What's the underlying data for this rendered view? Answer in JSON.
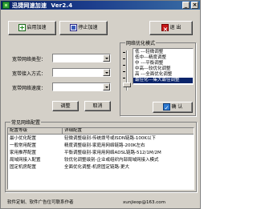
{
  "window": {
    "title": "迅捷网速加速",
    "version": "Ver2.4"
  },
  "toolbar": {
    "enable_label": "启用加速",
    "stop_label": "停止加速",
    "exit_label": "退 出"
  },
  "form": {
    "bandwidth_type_label": "宽带网络类型：",
    "access_mode_label": "宽带接入方式：",
    "speed_label": "宽带网络速度：",
    "bandwidth_type_value": "",
    "access_mode_value": "",
    "speed_value": "",
    "apply_label": "调整",
    "cancel_label": "取消"
  },
  "optimize_mode": {
    "title": "网络优化模式",
    "items": [
      "低  ---轻微调整",
      "低中---精度调整",
      "中  ---平衡调整",
      "中高---较优化调整",
      "高  ---全面优化调整",
      "最佳化---集大最佳调整"
    ],
    "selected_index": 5,
    "confirm_label": "确 认"
  },
  "config": {
    "title": "常见网络配置",
    "columns": [
      "配置等级",
      "详细配置"
    ],
    "rows": [
      [
        "最小优化配置",
        "轻微调整级别-传统拨号或ISDN链路-100K以下"
      ],
      [
        "一般常用配置",
        "精度调整级别-家庭用网络链路-200K左右"
      ],
      [
        "家用推荐配置",
        "平衡调整级别-家用用网络ADSL链路-512/1M/2M"
      ],
      [
        "局域网接入配置",
        "较优化调整级别-企业或组织内部局域网接入模式"
      ],
      [
        "固定机房配置",
        "全面优化调整-机房固定链路-更大"
      ]
    ]
  },
  "status": {
    "left": "软件定制、软件广告位可联系作者",
    "right": "xunjieop@163.com"
  },
  "colors": {
    "titlebar": "#0a246a",
    "selection": "#0a246a",
    "window_bg": "#d4d0c8"
  }
}
